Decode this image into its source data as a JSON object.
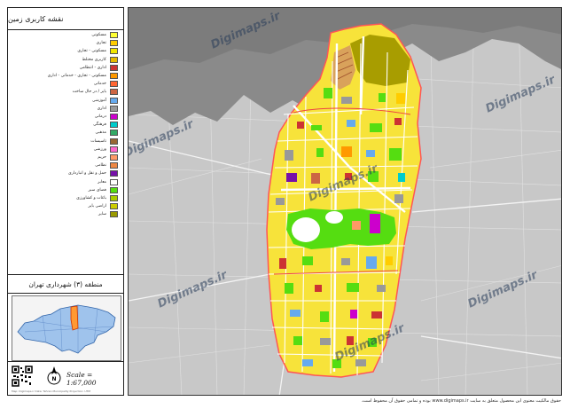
{
  "legend": {
    "title": "نقشه کاربری زمین",
    "items": [
      {
        "label": "مسکونی",
        "color": "#ffff33"
      },
      {
        "label": "تجاری",
        "color": "#ffcc00"
      },
      {
        "label": "مسکونی - تجاری",
        "color": "#f2e600"
      },
      {
        "label": "کاربری مختلط",
        "color": "#e6b800"
      },
      {
        "label": "اداری - انتظامی",
        "color": "#cc3333"
      },
      {
        "label": "مسکونی - تجاری - خدماتی - اداری",
        "color": "#ff9900"
      },
      {
        "label": "خدماتی",
        "color": "#ff6633"
      },
      {
        "label": "بایر / در حال ساخت",
        "color": "#cc6644"
      },
      {
        "label": "آموزشی",
        "color": "#66aaee"
      },
      {
        "label": "اداری",
        "color": "#999999"
      },
      {
        "label": "درمانی",
        "color": "#cc00cc"
      },
      {
        "label": "فرهنگی",
        "color": "#00cccc"
      },
      {
        "label": "مذهبی",
        "color": "#33aa66"
      },
      {
        "label": "تاسیسات",
        "color": "#996633"
      },
      {
        "label": "ورزشی",
        "color": "#ff66cc"
      },
      {
        "label": "حریم",
        "color": "#ff9966"
      },
      {
        "label": "نظامی",
        "color": "#ee8844"
      },
      {
        "label": "حمل و نقل و انبارداری",
        "color": "#7711aa"
      },
      {
        "label": "معابر",
        "color": "#ffffff"
      },
      {
        "label": "فضای سبز",
        "color": "#55dd11"
      },
      {
        "label": "باغات و کشاورزی",
        "color": "#aacc00"
      },
      {
        "label": "اراضی بایر",
        "color": "#cccc00"
      },
      {
        "label": "سایر",
        "color": "#999900"
      }
    ]
  },
  "region_title": "منطقه (۳) شهرداری تهران",
  "scale": "Scale = 1:67,000",
  "credit_small": "Map: Digimaps.ir   Data: Tehran Municipality   Projection: UTM",
  "watermark": "Digimaps.ir",
  "bottom_note": "حقوق مالکیت معنوی این محصول متعلق به سایت www.digimaps.ir بوده و تمامی حقوق آن محفوظ است.",
  "map_colors": {
    "background": "#c8c8c8",
    "mountain": "#8a8a8a",
    "district_fill": "#f7e33a",
    "district_border": "#ff5555",
    "park": "#55dd11",
    "street": "#ffffff"
  }
}
